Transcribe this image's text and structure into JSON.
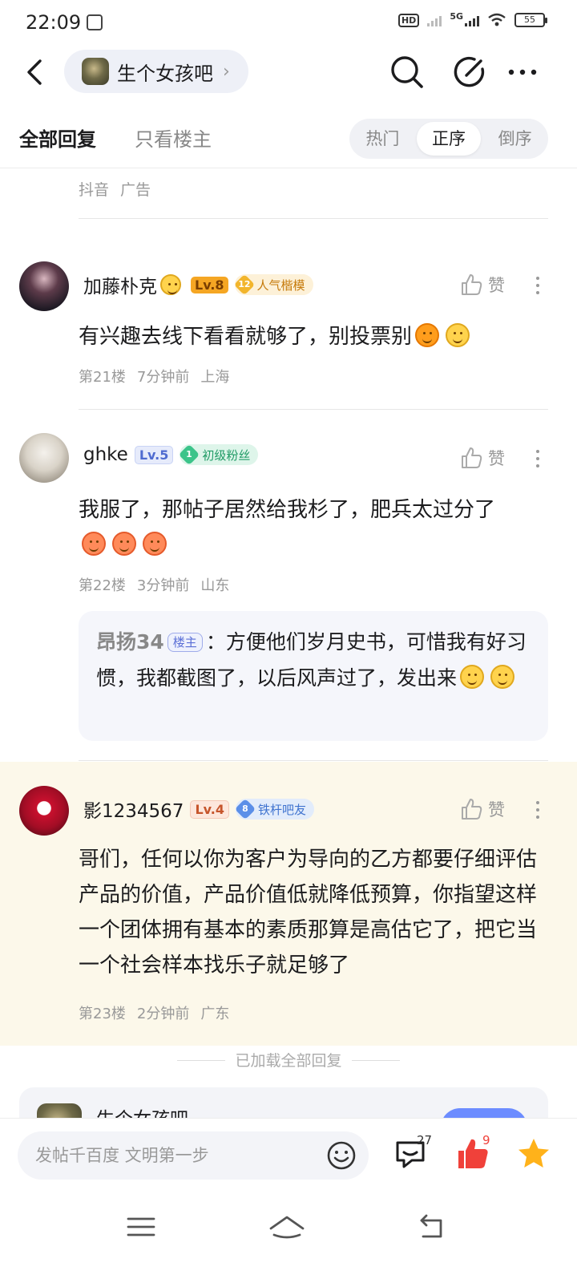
{
  "status": {
    "time": "22:09",
    "network": "5G",
    "hd": "HD",
    "battery": "55"
  },
  "nav": {
    "forum_name": "生个女孩吧",
    "chevron": "›"
  },
  "tabs": {
    "all": "全部回复",
    "op_only": "只看楼主",
    "sort": [
      "热门",
      "正序",
      "倒序"
    ],
    "sort_selected": "正序"
  },
  "ad": {
    "source": "抖音",
    "label": "广告"
  },
  "comments": [
    {
      "user": "加藤朴克",
      "level": "Lv.8",
      "badge_num": "12",
      "badge_text": "人气楷模",
      "text": "有兴趣去线下看看就够了，别投票别",
      "floor": "第21楼",
      "time": "7分钟前",
      "location": "上海",
      "like_label": "赞"
    },
    {
      "user": "ghke",
      "level": "Lv.5",
      "badge_num": "1",
      "badge_text": "初级粉丝",
      "text": "我服了，那帖子居然给我杉了，肥兵太过分了",
      "floor": "第22楼",
      "time": "3分钟前",
      "location": "山东",
      "like_label": "赞",
      "quote": {
        "user": "昂扬34",
        "tag": "楼主",
        "text": "：方便他们岁月史书，可惜我有好习惯，我都截图了，以后风声过了，发出来"
      }
    },
    {
      "user": "影1234567",
      "level": "Lv.4",
      "badge_num": "8",
      "badge_text": "铁杆吧友",
      "text": "哥们，任何以你为客户为导向的乙方都要仔细评估产品的价值，产品价值低就降低预算，你指望这样一个团体拥有基本的素质那算是高估它了，把它当一个社会样本找乐子就足够了",
      "floor": "第23楼",
      "time": "2分钟前",
      "location": "广东",
      "like_label": "赞"
    }
  ],
  "loaded_all": "已加载全部回复",
  "forum_card": {
    "name": "生个女孩吧"
  },
  "bottom": {
    "placeholder": "发帖千百度 文明第一步",
    "comment_count": "27",
    "like_count": "9"
  },
  "colors": {
    "accent": "#6c8cff",
    "highlight_bg": "#fcf8ea",
    "like_red": "#f0413a",
    "star": "#ffb21a"
  }
}
